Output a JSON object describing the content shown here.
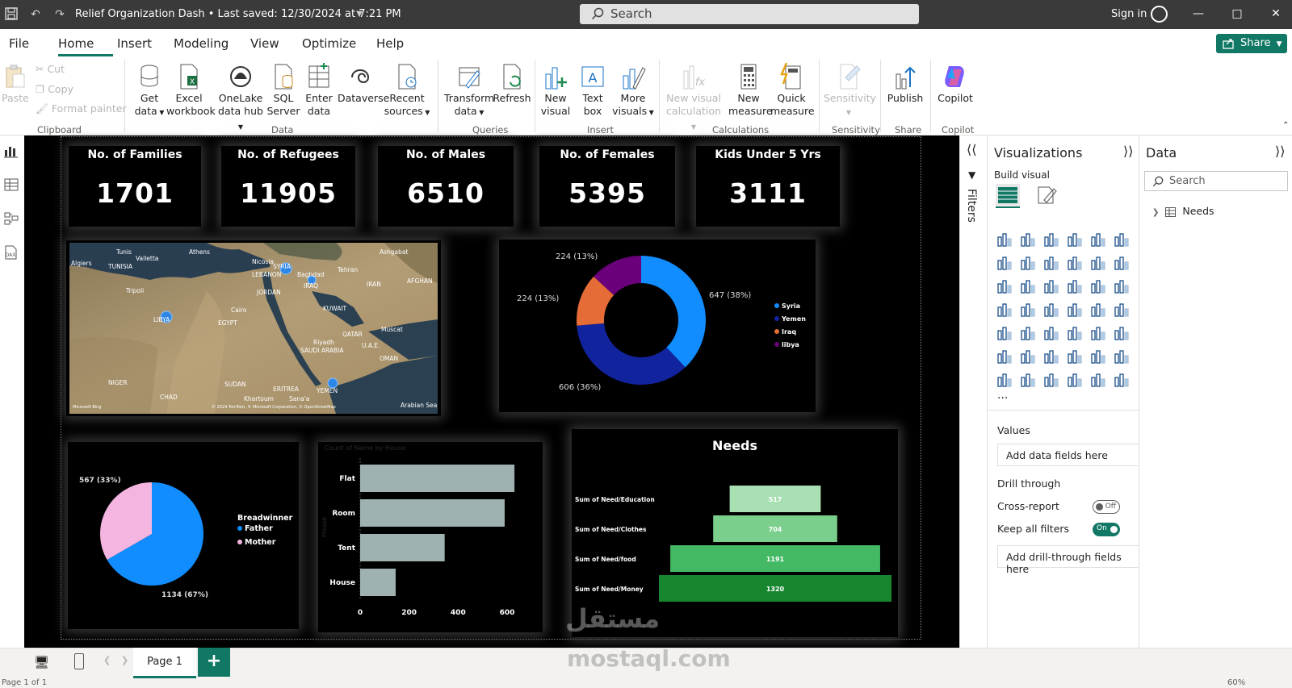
{
  "titlebar": {
    "doc_title": "Relief Organization Dash • Last saved: 12/30/2024 at 7:21 PM",
    "search": "Search",
    "signin": "Sign in"
  },
  "menu": {
    "items": [
      "File",
      "Home",
      "Insert",
      "Modeling",
      "View",
      "Optimize",
      "Help"
    ],
    "share": "Share"
  },
  "ribbon": {
    "clipboard": {
      "paste": "Paste",
      "cut": "Cut",
      "copy": "Copy",
      "format_painter": "Format painter",
      "label": "Clipboard"
    },
    "data": {
      "get_data": [
        "Get",
        "data"
      ],
      "excel": [
        "Excel",
        "workbook"
      ],
      "onelake": [
        "OneLake",
        "data hub"
      ],
      "sql": [
        "SQL",
        "Server"
      ],
      "enter": [
        "Enter",
        "data"
      ],
      "dataverse": "Dataverse",
      "recent": [
        "Recent",
        "sources"
      ],
      "label": "Data"
    },
    "queries": {
      "transform": [
        "Transform",
        "data"
      ],
      "refresh": "Refresh",
      "label": "Queries"
    },
    "insert": {
      "new_visual": [
        "New",
        "visual"
      ],
      "text_box": [
        "Text",
        "box"
      ],
      "more_visuals": [
        "More",
        "visuals"
      ],
      "label": "Insert"
    },
    "calculations": {
      "new_visual_calc": [
        "New visual",
        "calculation"
      ],
      "new_measure": [
        "New",
        "measure"
      ],
      "quick_measure": [
        "Quick",
        "measure"
      ],
      "label": "Calculations"
    },
    "sensitivity": {
      "btn": "Sensitivity",
      "label": "Sensitivity"
    },
    "share": {
      "publish": "Publish",
      "label": "Share"
    },
    "copilot": {
      "btn": "Copilot",
      "label": "Copilot"
    }
  },
  "kpis": [
    {
      "title": "No. of Families",
      "value": "1701"
    },
    {
      "title": "No. of Refugees",
      "value": "11905"
    },
    {
      "title": "No. of Males",
      "value": "6510"
    },
    {
      "title": "No. of Females",
      "value": "5395"
    },
    {
      "title": "Kids Under 5 Yrs",
      "value": "3111"
    }
  ],
  "map": {
    "labels": [
      "Tunis",
      "Athens",
      "Nicosia",
      "Ashgabat",
      "Algiers",
      "TUNISIA",
      "Valletta",
      "SYRIA",
      "Baghdad",
      "Tehran",
      "Tripoli",
      "LEBANON",
      "IRAQ",
      "IRAN",
      "AFGHAN",
      "JORDAN",
      "KUWAIT",
      "Cairo",
      "EGYPT",
      "LIBYA",
      "QATAR",
      "Muscat",
      "Riyadh",
      "U.A.E.",
      "SAUDI ARABIA",
      "OMAN",
      "NIGER",
      "SUDAN",
      "CHAD",
      "ERITREA",
      "Khartoum",
      "Sana'a",
      "YEMEN",
      "Arabian Sea"
    ],
    "credit": "© 2024 TomTom, © Microsoft Corporation, © OpenStreetMap",
    "bing": "Microsoft Bing"
  },
  "donut": {
    "chart_data": {
      "type": "pie",
      "categories": [
        "Syria",
        "Yemen",
        "Iraq",
        "libya"
      ],
      "values": [
        647,
        606,
        224,
        224
      ],
      "labels": [
        "647 (38%)",
        "606 (36%)",
        "224 (13%)",
        "224 (13%)"
      ],
      "colors": [
        "#118dff",
        "#12239e",
        "#e66c37",
        "#6b007b"
      ],
      "legend_position": "right"
    }
  },
  "pie": {
    "chart_data": {
      "type": "pie",
      "legend_title": "Breadwinner",
      "categories": [
        "Father",
        "Mother"
      ],
      "values": [
        1134,
        567
      ],
      "labels": [
        "1134 (67%)",
        "567 (33%)"
      ],
      "colors": [
        "#118dff",
        "#f4b6e0"
      ],
      "legend_position": "right"
    }
  },
  "bar": {
    "chart_data": {
      "type": "bar",
      "title": "Count of Name by House",
      "ylabel": "House",
      "categories": [
        "Flat",
        "Room",
        "Tent",
        "House"
      ],
      "values": [
        630,
        590,
        345,
        145
      ],
      "xlim": [
        0,
        600
      ],
      "ticks": [
        0,
        200,
        400,
        600
      ],
      "color": "#9fb1b1"
    }
  },
  "funnel": {
    "chart_data": {
      "type": "bar",
      "title": "Needs",
      "categories": [
        "Sum of Need/Education",
        "Sum of Need/Clothes",
        "Sum of Need/food",
        "Sum of Need/Money"
      ],
      "values": [
        517,
        704,
        1191,
        1320
      ],
      "colors": [
        "#a8dfb3",
        "#7bcf8d",
        "#43b964",
        "#18862f"
      ]
    }
  },
  "panes": {
    "filters": "Filters",
    "visualizations": "Visualizations",
    "build_visual": "Build visual",
    "values": "Values",
    "add_data": "Add data fields here",
    "drill": "Drill through",
    "cross": "Cross-report",
    "cross_state": "Off",
    "keep": "Keep all filters",
    "keep_state": "On",
    "add_drill": "Add drill-through fields here",
    "data": "Data",
    "data_search": "Search",
    "table": "Needs",
    "more": "..."
  },
  "pages": {
    "tab": "Page 1",
    "status": "Page 1 of 1",
    "zoom": "60%"
  },
  "watermark": {
    "ar": "مستقل",
    "en": "mostaql.com"
  }
}
